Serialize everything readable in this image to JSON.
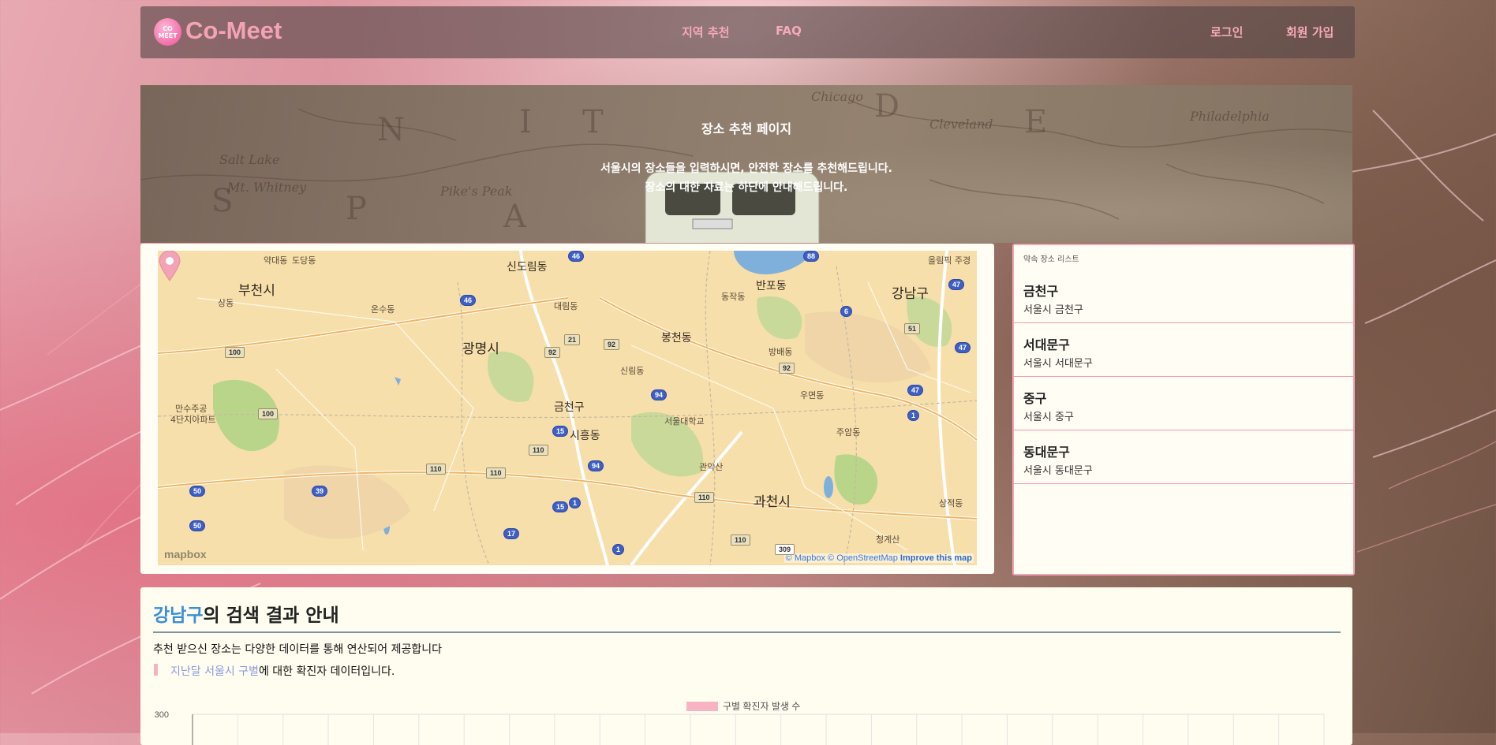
{
  "navbar": {
    "logo_text_top": "CO",
    "logo_text_bottom": "MEET",
    "brand": "Co-Meet",
    "links": {
      "region": "지역 추천",
      "faq": "FAQ",
      "login": "로그인",
      "signup": "회원 가입"
    }
  },
  "hero": {
    "title": "장소 추천 페이지",
    "line1": "서울시의 장소들을 입력하시면, 안전한 장소를 추천해드립니다.",
    "line2": "장소의 대한 자료는 하단에 안내해드립니다."
  },
  "map": {
    "labels": {
      "bucheon": "부천시",
      "gwangmyeong": "광명시",
      "bongcheon": "봉천동",
      "banpo": "반포동",
      "gangnam": "강남구",
      "gwacheon": "과천시",
      "siheung": "시흥동",
      "geumcheon": "금천구",
      "sindaebang": "신도림동",
      "daerim": "대림동",
      "sillim": "신림동",
      "snu": "서울대학교",
      "gwanak": "관악산",
      "umyeon": "우면동",
      "bangbae": "방배동",
      "jugam": "주암동",
      "dongjak": "동작동",
      "yakdae": "약대동",
      "dodang": "도당동",
      "sangdong": "상동",
      "onsu": "온수동",
      "manzu": "만수주공",
      "manzu2": "4단지아파트",
      "sangjeok": "상적동",
      "cheonggye": "청계산",
      "olympic": "올림픽 주경"
    },
    "attribution_mapbox": "© Mapbox",
    "attribution_osm": "© OpenStreetMap",
    "improve": "Improve this map",
    "logo": "mapbox",
    "shields": [
      "46",
      "88",
      "47",
      "46",
      "92",
      "21",
      "92",
      "100",
      "94",
      "92",
      "6",
      "51",
      "47",
      "47",
      "1",
      "15",
      "94",
      "110",
      "110",
      "110",
      "1",
      "15",
      "17",
      "39",
      "50",
      "50",
      "1",
      "110",
      "309",
      "100",
      "110"
    ]
  },
  "places": {
    "heading": "약속 장소 리스트",
    "items": [
      {
        "name": "금천구",
        "address": "서울시 금천구"
      },
      {
        "name": "서대문구",
        "address": "서울시 서대문구"
      },
      {
        "name": "중구",
        "address": "서울시 중구"
      },
      {
        "name": "동대문구",
        "address": "서울시 동대문구"
      }
    ]
  },
  "result": {
    "highlight": "강남구",
    "title_rest": "의 검색 결과 안내",
    "description": "추천 받으신 장소는 다양한 데이터를 통해 연산되어 제공합니다",
    "note_highlight": "지난달 서울시 구별",
    "note_rest": "에 대한 확진자 데이터입니다."
  },
  "chart_data": {
    "type": "bar",
    "legend": [
      "구별 확진자 발생 수"
    ],
    "y_tick_top": "300",
    "ylim": [
      0,
      300
    ],
    "series": [
      {
        "name": "구별 확진자 발생 수",
        "values": []
      }
    ],
    "colors": {
      "bar": "#f8b3c2"
    }
  }
}
